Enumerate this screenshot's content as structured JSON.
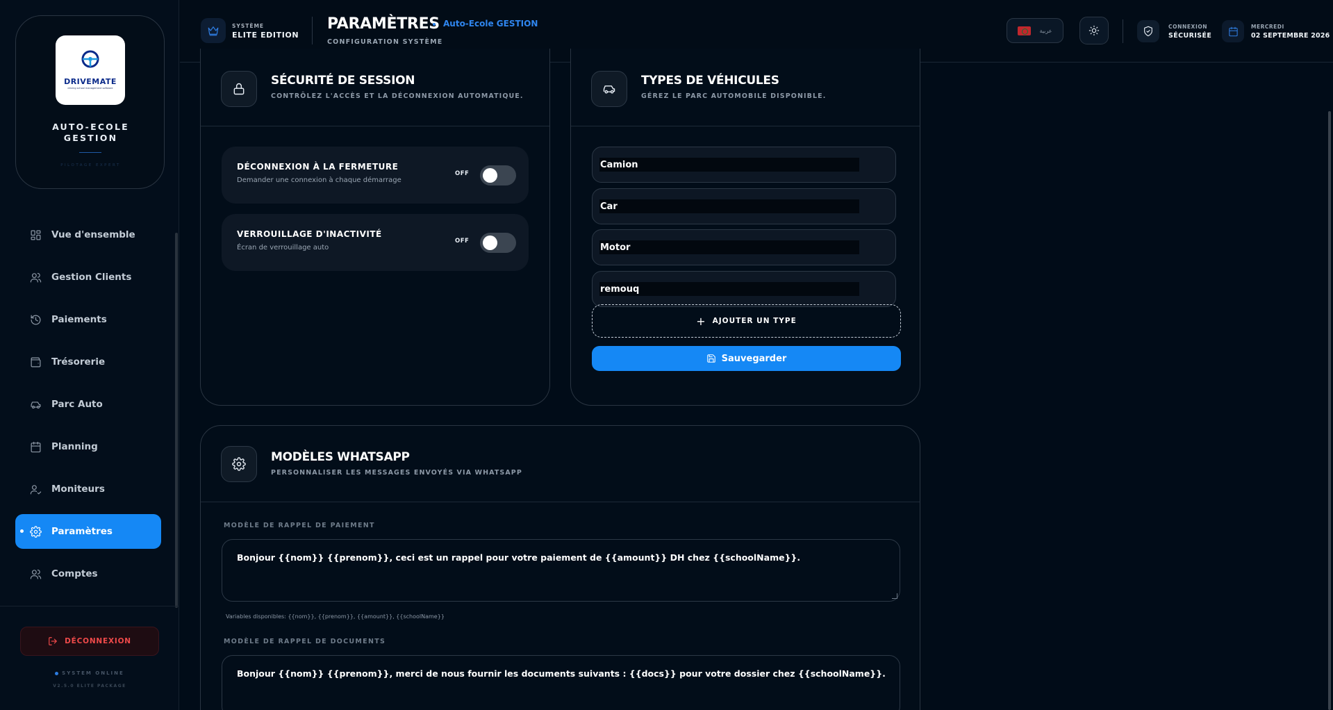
{
  "sidebar": {
    "logo_text": "DRIVEMATE",
    "logo_tagline": "driving school management software",
    "brand_name": "AUTO-ECOLE GESTION",
    "brand_tag": "PILOTAGE EXPERT",
    "nav": [
      {
        "label": "Vue d'ensemble",
        "icon": "grid-icon",
        "active": false
      },
      {
        "label": "Gestion Clients",
        "icon": "users-icon",
        "active": false
      },
      {
        "label": "Paiements",
        "icon": "history-icon",
        "active": false
      },
      {
        "label": "Trésorerie",
        "icon": "wallet-icon",
        "active": false
      },
      {
        "label": "Parc Auto",
        "icon": "car-icon",
        "active": false
      },
      {
        "label": "Planning",
        "icon": "calendar-icon",
        "active": false
      },
      {
        "label": "Moniteurs",
        "icon": "user-check-icon",
        "active": false
      },
      {
        "label": "Paramètres",
        "icon": "gear-icon",
        "active": true
      },
      {
        "label": "Comptes",
        "icon": "users-icon",
        "active": false
      }
    ],
    "logout_label": "DÉCONNEXION",
    "system_status": "SYSTEM ONLINE",
    "version": "V2.5.0 ELITE PACKAGE"
  },
  "header": {
    "edition_small": "SYSTÈME",
    "edition_big": "ELITE EDITION",
    "title": "PARAMÈTRES",
    "school": "Auto-Ecole GESTION",
    "subtitle": "CONFIGURATION SYSTÈME",
    "lang_label": "عربية",
    "connection_small": "CONNEXION",
    "connection_big": "SÉCURISÉE",
    "day": "MERCREDI",
    "date": "02 SEPTEMBRE 2026"
  },
  "session_card": {
    "title": "SÉCURITÉ DE SESSION",
    "subtitle": "CONTRÔLEZ L'ACCÈS ET LA DÉCONNEXION AUTOMATIQUE.",
    "toggles": [
      {
        "title": "DÉCONNEXION À LA FERMETURE",
        "desc": "Demander une connexion à chaque démarrage",
        "state": "OFF"
      },
      {
        "title": "VERROUILLAGE D'INACTIVITÉ",
        "desc": "Écran de verrouillage auto",
        "state": "OFF"
      }
    ]
  },
  "vehicle_card": {
    "title": "TYPES DE VÉHICULES",
    "subtitle": "GÉREZ LE PARC AUTOMOBILE DISPONIBLE.",
    "types": [
      "Camion",
      "Car",
      "Motor",
      "remouq"
    ],
    "add_label": "AJOUTER UN TYPE",
    "save_label": "Sauvegarder"
  },
  "whatsapp_card": {
    "title": "MODÈLES WHATSAPP",
    "subtitle": "PERSONNALISER LES MESSAGES ENVOYÉS VIA WHATSAPP",
    "payment_label": "MODÈLE DE RAPPEL DE PAIEMENT",
    "payment_text": "Bonjour {{nom}} {{prenom}}, ceci est un rappel pour votre paiement de {{amount}} DH chez {{schoolName}}.",
    "variables": "Variables disponibles: {{nom}}, {{prenom}}, {{amount}}, {{schoolName}}",
    "documents_label": "MODÈLE DE RAPPEL DE DOCUMENTS",
    "documents_text": "Bonjour {{nom}} {{prenom}}, merci de nous fournir les documents suivants : {{docs}} pour votre dossier chez {{schoolName}}."
  },
  "colors": {
    "accent": "#1588f5",
    "background": "#010c18",
    "danger": "#ef4a4a"
  }
}
